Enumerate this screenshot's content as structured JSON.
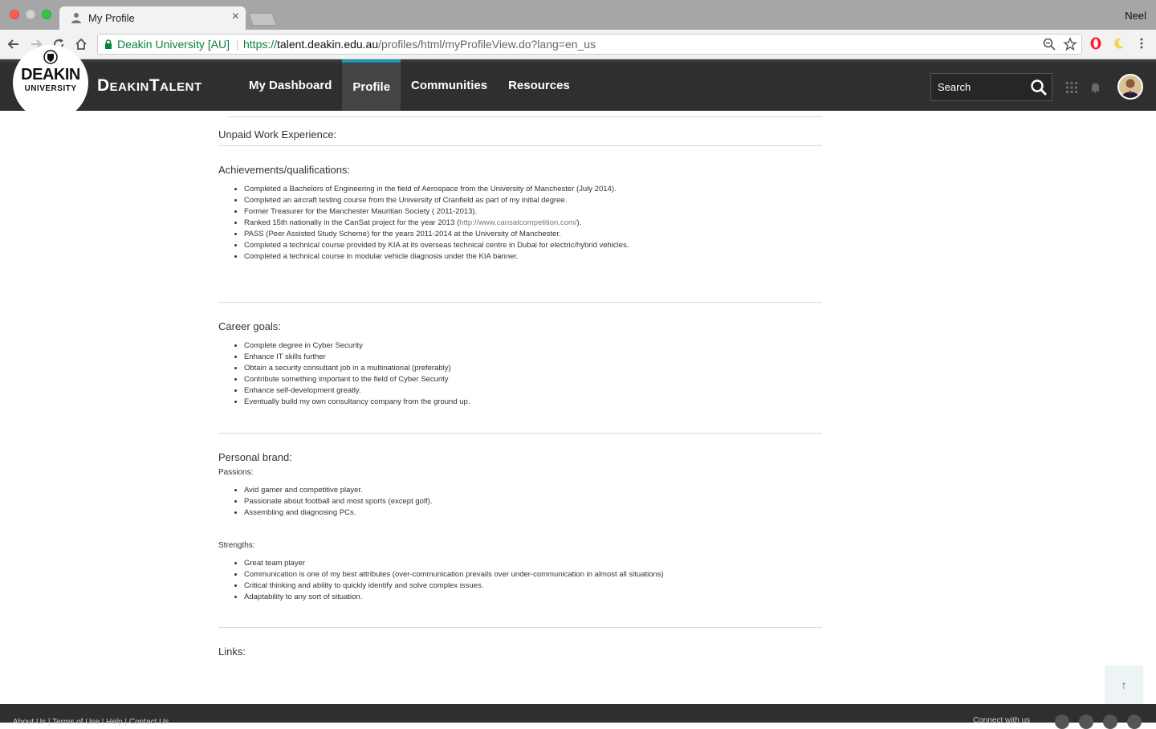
{
  "browser": {
    "tab_title": "My Profile",
    "tab_close": "×",
    "profile_name": "Neel",
    "site_identity": "Deakin University [AU]",
    "url_scheme": "https://",
    "url_host": "talent.deakin.edu.au",
    "url_path": "/profiles/html/myProfileView.do?lang=en_us"
  },
  "site": {
    "logo_deakin": "DEAKIN",
    "logo_university": "UNIVERSITY",
    "brand": "DeakinTalent",
    "nav": [
      {
        "label": "My Dashboard"
      },
      {
        "label": "Profile",
        "active": true
      },
      {
        "label": "Communities"
      },
      {
        "label": "Resources"
      }
    ],
    "search_label": "Search"
  },
  "profile": {
    "unpaid_title": "Unpaid Work Experience:",
    "achievements_title": "Achievements/qualifications:",
    "achievements": [
      "Completed a Bachelors of Engineering in the field of Aerospace from the University of Manchester (July 2014).",
      "Completed an aircraft testing course from the University of Cranfield as part of my initial degree.",
      "Former Treasurer for the Manchester Mauritian Society ( 2011-2013).",
      "Ranked 15th nationally in the CanSat project for the year 2013 (",
      "http://www.cansatcompetition.com/",
      ").",
      "PASS (Peer Assisted Study Scheme) for the years 2011-2014 at the University of Manchester.",
      "Completed a technical course provided by KIA at its overseas technical centre in Dubai for electric/hybrid vehicles.",
      "Completed a technical course in modular vehicle diagnosis under the KIA banner."
    ],
    "career_title": "Career goals:",
    "career_goals": [
      "Complete degree in Cyber Security",
      "Enhance IT skills further",
      "Obtain a security consultant job in a multinational (preferably)",
      "Contribute something important to the field of Cyber Security",
      "Enhance self-development greatly.",
      "Eventually build my own consultancy company from the ground up."
    ],
    "brand_title": "Personal brand:",
    "passions_label": "Passions:",
    "passions": [
      "Avid gamer and competitive player.",
      "Passionate about football and most sports (except golf).",
      "Assembling and diagnosing PCs."
    ],
    "strengths_label": "Strengths:",
    "strengths": [
      "Great team player",
      "Communication is one of my best attributes (over-communication prevails over under-communication in almost all situations)",
      "Critical thinking and ability to quickly identify and solve complex issues.",
      "Adaptability to any sort of situation."
    ],
    "links_title": "Links:"
  },
  "back_to_top": "↑",
  "footer": {
    "links": "About Us  |  Terms of Use  |  Help  |  Contact Us",
    "connect": "Connect with us"
  }
}
